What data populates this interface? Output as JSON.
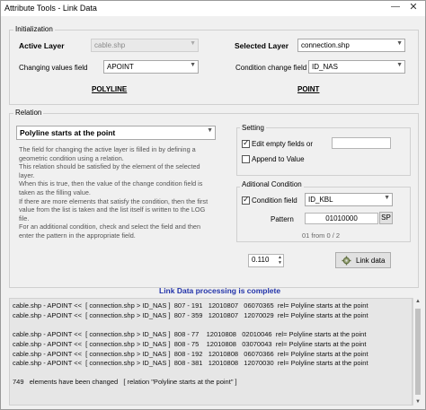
{
  "window": {
    "title": "Attribute Tools  -  Link Data",
    "minimize": "—",
    "close": "✕"
  },
  "initialization": {
    "group_label": "Initialization",
    "active_layer_label": "Active Layer",
    "active_layer_value": "cable.shp",
    "changing_field_label": "Changing values field",
    "changing_field_value": "APOINT",
    "active_geometry": "POLYLINE",
    "selected_layer_label": "Selected Layer",
    "selected_layer_value": "connection.shp",
    "condition_field_label": "Condition change field",
    "condition_field_value": "ID_NAS",
    "selected_geometry": "POINT"
  },
  "relation": {
    "group_label": "Relation",
    "relation_value": "Polyline starts at the point",
    "description": "The field for changing the active layer is filled in by defining a geometric condition using a relation.\nThis relation should be satisfied by the element of the selected layer.\nWhen this is true, then the value of the change condition field is taken as the filling value.\nIf there are more elements that satisfy the condition, then the first value from the list is taken and the list itself is written to the LOG file.\nFor an additional condition, check and select the field and then enter the pattern in the appropriate field."
  },
  "setting": {
    "group_label": "Setting",
    "edit_empty_label": "Edit empty fields or",
    "edit_empty_checked": true,
    "edit_empty_value": "",
    "append_label": "Append to Value",
    "append_checked": false
  },
  "additional_condition": {
    "group_label": "Aditional Condition",
    "condition_field_label": "Condition field",
    "condition_field_checked": true,
    "condition_field_value": "ID_KBL",
    "pattern_label": "Pattern",
    "pattern_value": "01010000",
    "sp_button": "SP",
    "counter": "01 from 0 / 2"
  },
  "actions": {
    "tolerance_value": "0.110",
    "link_button": "Link data",
    "status": "Link Data processing is complete"
  },
  "log": {
    "lines": [
      "cable.shp - APOINT <<  [ connection.shp > ID_NAS ]  807 - 191   12010807   06070365  rel= Polyline starts at the point",
      "cable.shp - APOINT <<  [ connection.shp > ID_NAS ]  807 - 359   12010807   12070029  rel= Polyline starts at the point",
      "",
      "cable.shp - APOINT <<  [ connection.shp > ID_NAS ]  808 - 77    12010808   02010046  rel= Polyline starts at the point",
      "cable.shp - APOINT <<  [ connection.shp > ID_NAS ]  808 - 75    12010808   03070043  rel= Polyline starts at the point",
      "cable.shp - APOINT <<  [ connection.shp > ID_NAS ]  808 - 192   12010808   06070366  rel= Polyline starts at the point",
      "cable.shp - APOINT <<  [ connection.shp > ID_NAS ]  808 - 381   12010808   12070030  rel= Polyline starts at the point",
      "",
      "749   elements have been changed   [ relation \"Polyline starts at the point\" ]"
    ]
  }
}
